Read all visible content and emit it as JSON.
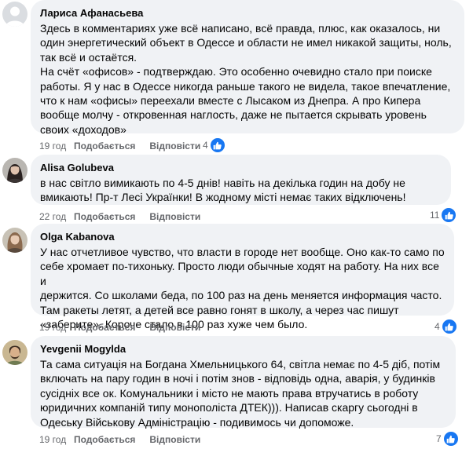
{
  "comments": [
    {
      "author": "Лариса Афанасьева",
      "lines": [
        "Здесь в комментариях уже всё написано, всё правда, плюс, как оказалось, ни",
        "один энергетический объект в Одессе и области не имел никакой защиты, ноль,",
        "так всё и остаётся.",
        "На счёт «офисов» - подтверждаю. Это особенно очевидно стало при поиске",
        "работы. Я у нас в Одессе никогда раньше такого не видела, такое впечатление,",
        "что к нам «офисы» переехали вместе с Лысаком из Днепра. А про Кипера",
        "вообще молчу - откровенная наглость, даже не пытается скрывать уровень",
        "своих «доходов»"
      ],
      "time": "19 год",
      "like_label": "Подобається",
      "reply_label": "Відповісти",
      "reactions": "4"
    },
    {
      "author": "Alisa Golubeva",
      "lines": [
        "в нас світло вимикають по 4-5 днів! навіть на декілька годин на добу не",
        "вмикають! Пр-т Лесі Українки! В жодному місті немає таких відключень!"
      ],
      "time": "22 год",
      "like_label": "Подобається",
      "reply_label": "Відповісти",
      "reactions": "11"
    },
    {
      "author": "Olga Kabanova",
      "lines": [
        "У нас отчетливое чувство, что власти в городе нет вообще. Оно как-то само по",
        "себе хромает по-тихоньку. Просто люди обычные ходят на работу. На них все и",
        "держится. Со школами беда, по 100 раз на день меняется информация часто.",
        "Там ракеты летят, а детей все равно гонят в школу, а через час пишут",
        "«заберите». Короче стало в 100 раз хуже чем было."
      ],
      "time": "19 год",
      "like_label": "Подобається",
      "reply_label": "Відповісти",
      "reactions": "4"
    },
    {
      "author": "Yevgenii Mogylda",
      "lines": [
        "Та сама ситуація на Богдана Хмельницького 64, світла немає по 4-5 діб, потім",
        "включать на пару годин в ночі і потім знов - відповідь одна, аварія, у будинків",
        "сусідніх все ок. Комунальники і місто не мають права втручатись в роботу",
        "юридичних компаній типу монополіста ДТЕК))). Написав скаргу сьогодні в",
        "Одеську Військову Адміністрацію - подивимось чи допоможе."
      ],
      "time": "19 год",
      "like_label": "Подобається",
      "reply_label": "Відповісти",
      "reactions": "7"
    }
  ],
  "colors": {
    "bubble": "#f0f2f5",
    "meta_text": "#65676b",
    "like_blue": "#1877f2"
  }
}
